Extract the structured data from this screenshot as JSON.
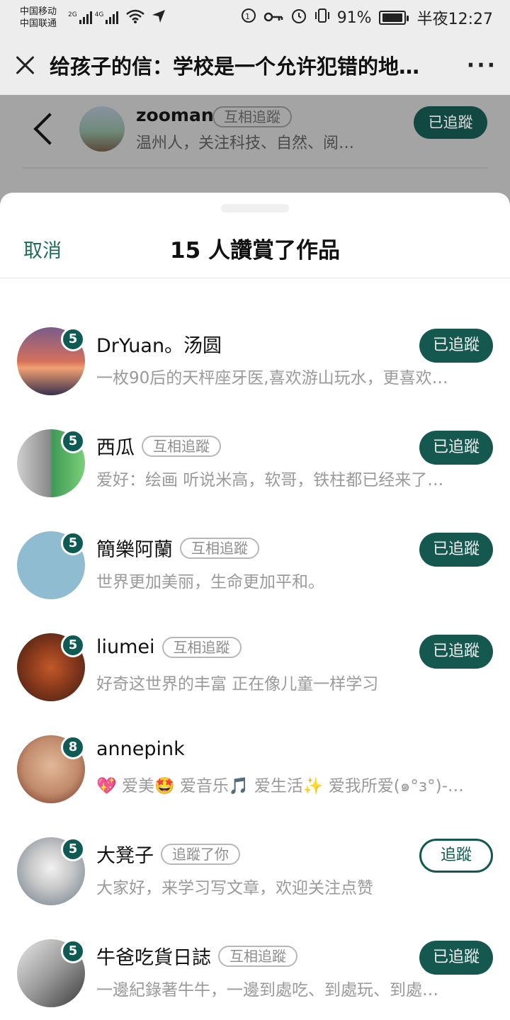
{
  "status_bar": {
    "carrier1": "中国移动",
    "carrier2": "中国联通",
    "net1": "2G",
    "net2": "4G",
    "battery_pct": "91%",
    "time": "半夜12:27"
  },
  "header": {
    "title": "给孩子的信：学校是一个允许犯错的地…",
    "more": "···"
  },
  "author": {
    "name": "zooman",
    "tag": "互相追蹤",
    "bio": "温州人，关注科技、自然、阅…",
    "follow_label": "已追蹤"
  },
  "sheet": {
    "cancel_label": "取消",
    "title": "15 人讚賞了作品"
  },
  "colors": {
    "accent": "#14584f",
    "cancel": "#1f6b5a"
  },
  "users": [
    {
      "name": "DrYuan。汤圆",
      "tag": "",
      "bio": "一枚90后的天枰座牙医,喜欢游山玩水，更喜欢…",
      "badge": "5",
      "button": "已追蹤",
      "button_style": "filled"
    },
    {
      "name": "西瓜",
      "tag": "互相追蹤",
      "bio": "爱好：绘画 听说米高，软哥，铁柱都已经来了…",
      "badge": "5",
      "button": "已追蹤",
      "button_style": "filled"
    },
    {
      "name": "簡樂阿蘭",
      "tag": "互相追蹤",
      "bio": "世界更加美丽，生命更加平和。",
      "badge": "5",
      "button": "已追蹤",
      "button_style": "filled"
    },
    {
      "name": "liumei",
      "tag": "互相追蹤",
      "bio": "好奇这世界的丰富 正在像儿童一样学习",
      "badge": "5",
      "button": "已追蹤",
      "button_style": "filled"
    },
    {
      "name": "annepink",
      "tag": "",
      "bio": "💖 爱美🤩 爱音乐🎵 爱生活✨ 爱我所爱(๑°з°)-…",
      "badge": "8",
      "button": "",
      "button_style": "none"
    },
    {
      "name": "大凳子",
      "tag": "追蹤了你",
      "bio": "大家好，来学习写文章，欢迎关注点赞",
      "badge": "5",
      "button": "追蹤",
      "button_style": "outline"
    },
    {
      "name": "牛爸吃貨日誌",
      "tag": "互相追蹤",
      "bio": "一邊紀錄著牛牛，一邊到處吃、到處玩、到處…",
      "badge": "5",
      "button": "已追蹤",
      "button_style": "filled"
    }
  ]
}
